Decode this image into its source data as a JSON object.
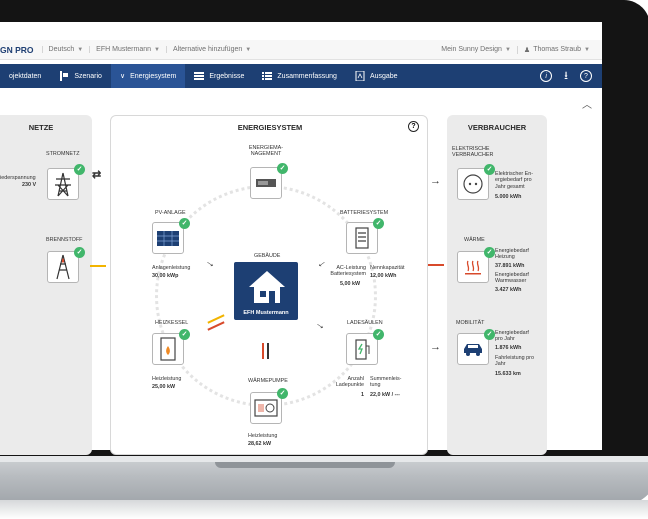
{
  "topbar": {
    "brand": "GN PRO",
    "language": "Deutsch",
    "project": "EFH Mustermann",
    "alternative": "Alternative hinzufügen",
    "account": "Mein Sunny Design",
    "user": "Thomas Straub"
  },
  "nav": {
    "items": [
      {
        "label": "ojektdaten"
      },
      {
        "label": "Szenario"
      },
      {
        "label": "Energiesystem"
      },
      {
        "label": "Ergebnisse"
      },
      {
        "label": "Zusammenfassung"
      },
      {
        "label": "Ausgabe"
      }
    ]
  },
  "netze": {
    "title": "NETZE",
    "stromnetz": {
      "label": "STROMNETZ",
      "info": "iederspannung",
      "value": "230 V"
    },
    "brennstoff": {
      "label": "BRENNSTOFF"
    }
  },
  "energiesystem": {
    "title": "ENERGIESYSTEM",
    "help": "?",
    "energiemanagement": {
      "label": "ENERGIEMA-\nNAGEMENT"
    },
    "pv": {
      "label": "PV-ANLAGE",
      "info": "Anlagenleistung",
      "value": "30,00 kWp"
    },
    "batterie": {
      "label": "BATTERIESYSTEM",
      "info1": "AC-Leistung\nBatteriesystem",
      "value1": "5,00 kW",
      "info2": "Nennkapazität",
      "value2": "12,00 kWh"
    },
    "gebaeude": {
      "label": "GEBÄUDE",
      "name": "EFH Mustermann"
    },
    "heizkessel": {
      "label": "HEIZKESSEL",
      "info": "Heizleistung",
      "value": "25,00 kW"
    },
    "ladesaeulen": {
      "label": "LADESÄULEN",
      "info1": "Anzahl\nLadepunkte",
      "value1": "1",
      "info2": "Summenleis-\ntung",
      "value2": "22,0 kW / ---"
    },
    "waermepumpe": {
      "label": "WÄRMEPUMPE",
      "info": "Heizleistung",
      "value": "28,62 kW"
    }
  },
  "verbraucher": {
    "title": "VERBRAUCHER",
    "elektrisch": {
      "label": "ELEKTRISCHE\nVERBRAUCHER",
      "info": "Elektrischer En-\nergiebedarf pro\nJahr gesamt",
      "value": "5.000 kWh"
    },
    "waerme": {
      "label": "WÄRME",
      "info1": "Energiebedarf\nHeizung",
      "value1": "37.891 kWh",
      "info2": "Energiebedarf\nWarmwasser",
      "value2": "3.427 kWh"
    },
    "mobilitaet": {
      "label": "MOBILITÄT",
      "info1": "Energiebedarf\npro Jahr",
      "value1": "1.876 kWh",
      "info2": "Fahrleistung pro\nJahr",
      "value2": "15.633 km"
    }
  },
  "colors": {
    "navy": "#1d3f73",
    "active": "#2a5496",
    "ok": "#41b66b",
    "red": "#d84a2b",
    "yellow": "#f2b400"
  }
}
